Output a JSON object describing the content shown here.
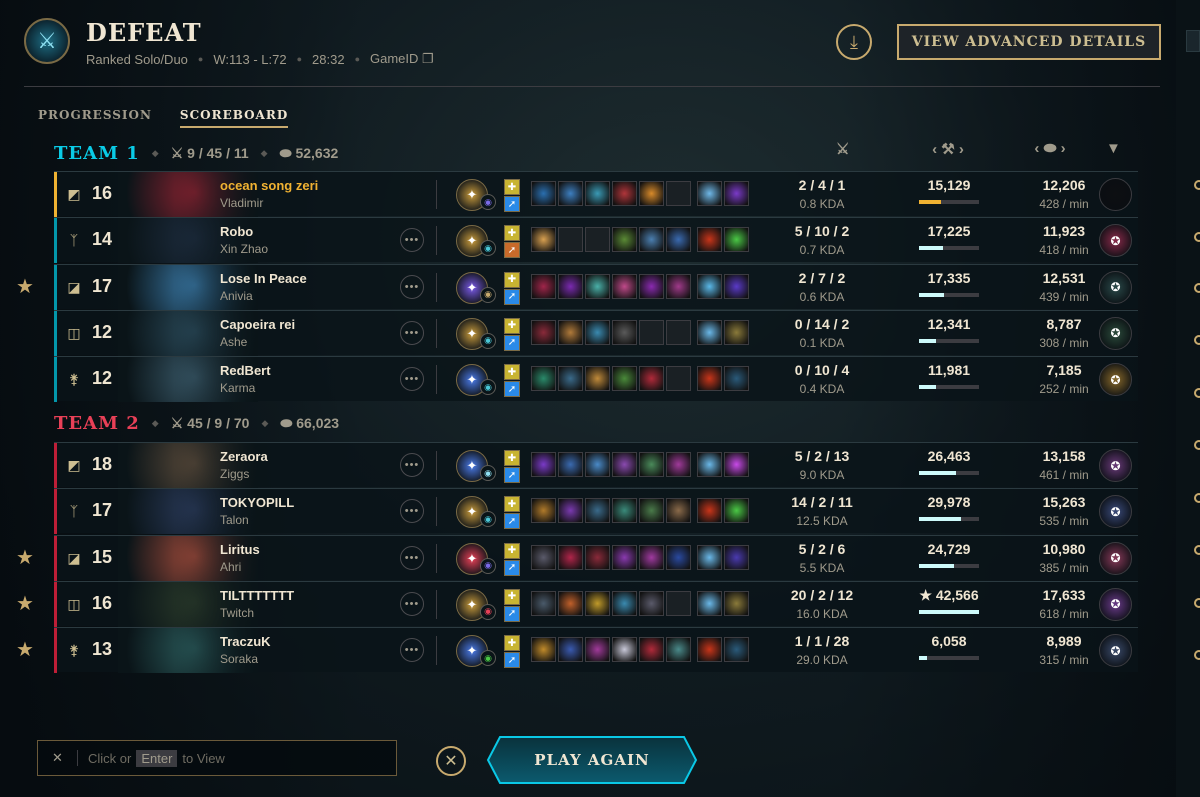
{
  "header": {
    "result": "DEFEAT",
    "queue": "Ranked Solo/Duo",
    "record": "W:113 - L:72",
    "duration": "28:32",
    "game_id_label": "GameID",
    "advanced_label": "VIEW ADVANCED DETAILS"
  },
  "tabs": [
    {
      "label": "PROGRESSION",
      "active": false
    },
    {
      "label": "SCOREBOARD",
      "active": true
    }
  ],
  "teams": [
    {
      "name": "TEAM 1",
      "color": "#0acbe6",
      "kda": "9 / 45 / 11",
      "gold": "52,632",
      "bar_color": "#0397ab",
      "players": [
        {
          "position": "mid",
          "level": "16",
          "summoner": "ocean song zeri",
          "champion": "Vladimir",
          "is_self": true,
          "kda": "2 / 4 / 1",
          "kda_ratio": "0.8 KDA",
          "damage": "15,129",
          "damage_pct": 0.36,
          "gold": "12,206",
          "gpm": "428 / min",
          "honor": false,
          "splash": "#8a2230",
          "rune": "#c89b3c",
          "rune2": "#7a6ae8",
          "items": [
            "#2a6fb0",
            "#3d7fc0",
            "#3a9ab5",
            "#b0353a",
            "#d88a2a",
            "",
            "#6fb8e8",
            "#7a3ac8"
          ],
          "badge": "#0d0f12"
        },
        {
          "position": "jungle",
          "level": "14",
          "summoner": "Robo",
          "champion": "Xin Zhao",
          "is_self": false,
          "kda": "5 / 10 / 2",
          "kda_ratio": "0.7 KDA",
          "damage": "17,225",
          "damage_pct": 0.4,
          "gold": "11,923",
          "gpm": "418 / min",
          "honor": false,
          "splash": "#1d2c3e",
          "rune": "#c89b3c",
          "rune2": "#4ac8d8",
          "items": [
            "#d8a050",
            "",
            "",
            "#5a8a35",
            "#4b7fb0",
            "#3a6ab0",
            "#c8351a",
            "#4ac845"
          ],
          "badge": "#8a2a4a"
        },
        {
          "position": "top",
          "level": "17",
          "summoner": "Lose In Peace",
          "champion": "Anivia",
          "is_self": false,
          "kda": "2 / 7 / 2",
          "kda_ratio": "0.6 KDA",
          "damage": "17,335",
          "damage_pct": 0.41,
          "gold": "12,531",
          "gpm": "439 / min",
          "honor": true,
          "splash": "#3a7aa8",
          "rune": "#7a5ae8",
          "rune2": "#c8aa6e",
          "items": [
            "#a0254a",
            "#7a2ab0",
            "#4ab0a8",
            "#c04a8a",
            "#8a2ab0",
            "#a03a8a",
            "#5ab8e8",
            "#5a3ac8"
          ],
          "badge": "#2a4a4a"
        },
        {
          "position": "bot",
          "level": "12",
          "summoner": "Capoeira rei",
          "champion": "Ashe",
          "is_self": false,
          "kda": "0 / 14 / 2",
          "kda_ratio": "0.1 KDA",
          "damage": "12,341",
          "damage_pct": 0.29,
          "gold": "8,787",
          "gpm": "308 / min",
          "honor": false,
          "splash": "#2a4a5a",
          "rune": "#c89b3c",
          "rune2": "#4ac8d8",
          "items": [
            "#8a2a3a",
            "#b07a3a",
            "#3a8ab0",
            "#5a5a5a",
            "",
            "",
            "#6ab8e8",
            "#8a7a3a"
          ],
          "badge": "#2a4a3a"
        },
        {
          "position": "support",
          "level": "12",
          "summoner": "RedBert",
          "champion": "Karma",
          "is_self": false,
          "kda": "0 / 10 / 4",
          "kda_ratio": "0.4 KDA",
          "damage": "11,981",
          "damage_pct": 0.28,
          "gold": "7,185",
          "gpm": "252 / min",
          "honor": false,
          "splash": "#3a5a6a",
          "rune": "#4a7ae8",
          "rune2": "#4ac8d8",
          "items": [
            "#2a8a6a",
            "#3a6a8a",
            "#c08a3a",
            "#4a8a3a",
            "#b02a3a",
            "",
            "#c8351a",
            "#2a5a7a"
          ],
          "badge": "#8a6a2a"
        }
      ]
    },
    {
      "name": "TEAM 2",
      "color": "#e84057",
      "kda": "45 / 9 / 70",
      "gold": "66,023",
      "bar_color": "#be1e37",
      "players": [
        {
          "position": "mid",
          "level": "18",
          "summoner": "Zeraora",
          "champion": "Ziggs",
          "is_self": false,
          "kda": "5 / 2 / 13",
          "kda_ratio": "9.0 KDA",
          "damage": "26,463",
          "damage_pct": 0.62,
          "gold": "13,158",
          "gpm": "461 / min",
          "honor": false,
          "splash": "#5a4a3a",
          "rune": "#4a7ae8",
          "rune2": "#8fe1f2",
          "items": [
            "#7a3ac8",
            "#3a6ab0",
            "#4a8ac8",
            "#8a4ab0",
            "#4a8a5a",
            "#a03a9a",
            "#6ab8e8",
            "#c84ae8"
          ],
          "badge": "#6a3a7a"
        },
        {
          "position": "jungle",
          "level": "17",
          "summoner": "TOKYOPILL",
          "champion": "Talon",
          "is_self": false,
          "kda": "14 / 2 / 11",
          "kda_ratio": "12.5 KDA",
          "damage": "29,978",
          "damage_pct": 0.7,
          "gold": "15,263",
          "gpm": "535 / min",
          "honor": false,
          "splash": "#2a3a5a",
          "rune": "#c89b3c",
          "rune2": "#4ac8d8",
          "items": [
            "#b07a2a",
            "#7a3ab0",
            "#3a6a8a",
            "#3a8a7a",
            "#4a7a4a",
            "#8a6a4a",
            "#c8351a",
            "#4ac845"
          ],
          "badge": "#3a4a7a"
        },
        {
          "position": "top",
          "level": "15",
          "summoner": "Liritus",
          "champion": "Ahri",
          "is_self": false,
          "kda": "5 / 2 / 6",
          "kda_ratio": "5.5 KDA",
          "damage": "24,729",
          "damage_pct": 0.58,
          "gold": "10,980",
          "gpm": "385 / min",
          "honor": true,
          "splash": "#a04a3a",
          "rune": "#e84057",
          "rune2": "#7a6ae8",
          "items": [
            "#5a5a6a",
            "#b0254a",
            "#8a2a3a",
            "#8a3ab0",
            "#a03aa0",
            "#2a4aa0",
            "#6ab8e8",
            "#4a3ab0"
          ],
          "badge": "#8a3a5a"
        },
        {
          "position": "bot",
          "level": "16",
          "summoner": "TILTTTTTTT",
          "champion": "Twitch",
          "is_self": false,
          "kda": "20 / 2 / 12",
          "kda_ratio": "16.0 KDA",
          "damage": "42,566",
          "damage_pct": 1.0,
          "top_damage": true,
          "gold": "17,633",
          "gpm": "618 / min",
          "honor": true,
          "splash": "#2a3a2a",
          "rune": "#c89b3c",
          "rune2": "#e84057",
          "items": [
            "#4a5a6a",
            "#c0602a",
            "#c09a2a",
            "#3a8ab0",
            "#5a5a6a",
            "",
            "#6ab8e8",
            "#8a7a3a"
          ],
          "badge": "#6a3a8a"
        },
        {
          "position": "support",
          "level": "13",
          "summoner": "TraczuK",
          "champion": "Soraka",
          "is_self": false,
          "kda": "1 / 1 / 28",
          "kda_ratio": "29.0 KDA",
          "damage": "6,058",
          "damage_pct": 0.14,
          "gold": "8,989",
          "gpm": "315 / min",
          "honor": true,
          "splash": "#2a5a5a",
          "rune": "#4a7ae8",
          "rune2": "#4ac845",
          "items": [
            "#c08a2a",
            "#3a5ab0",
            "#a03a9a",
            "#c8c8d8",
            "#b02a3a",
            "#4a8a8a",
            "#c8351a",
            "#2a5a7a"
          ],
          "badge": "#3a4a6a"
        }
      ]
    }
  ],
  "footer": {
    "chat_prefix": "Click or",
    "chat_key": "Enter",
    "chat_suffix": "to View",
    "play_again": "PLAY AGAIN"
  }
}
